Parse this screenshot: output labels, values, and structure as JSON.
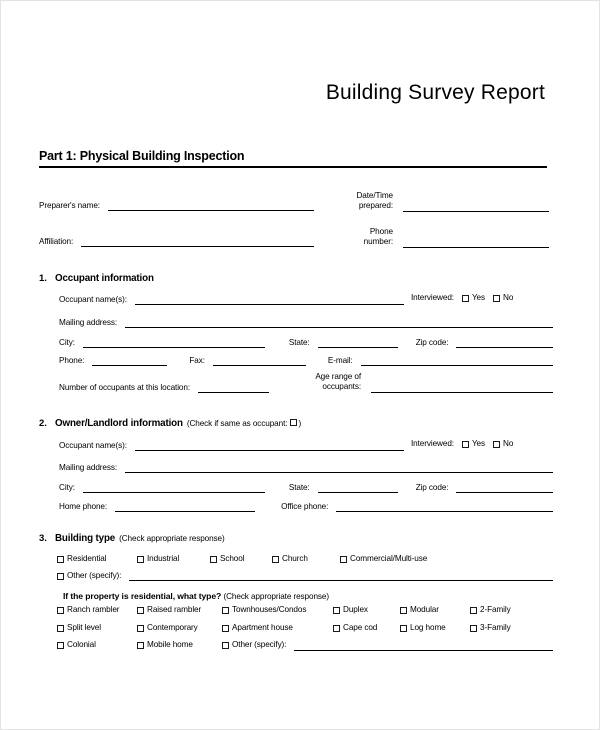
{
  "document": {
    "title": "Building Survey Report",
    "part_header": "Part 1:  Physical Building Inspection"
  },
  "preparer": {
    "name_label": "Preparer's name:",
    "affiliation_label": "Affiliation:",
    "date_label_line1": "Date/Time",
    "date_label_line2": "prepared:",
    "phone_label_line1": "Phone",
    "phone_label_line2": "number:",
    "name_value": "",
    "affiliation_value": "",
    "date_value": "",
    "phone_value": ""
  },
  "section1": {
    "number": "1.",
    "title": "Occupant information",
    "occupant_names_label": "Occupant name(s):",
    "mailing_address_label": "Mailing address:",
    "city_label": "City:",
    "state_label": "State:",
    "zip_label": "Zip code:",
    "phone_label": "Phone:",
    "fax_label": "Fax:",
    "email_label": "E-mail:",
    "num_occupants_label": "Number of occupants at this location:",
    "age_range_label_line1": "Age range of",
    "age_range_label_line2": "occupants:",
    "interviewed_label": "Interviewed:",
    "yes_label": "Yes",
    "no_label": "No"
  },
  "section2": {
    "number": "2.",
    "title": "Owner/Landlord information",
    "note_prefix": "(Check if same as occupant:",
    "note_suffix": ")",
    "occupant_names_label": "Occupant name(s):",
    "mailing_address_label": "Mailing address:",
    "city_label": "City:",
    "state_label": "State:",
    "zip_label": "Zip code:",
    "home_phone_label": "Home phone:",
    "office_phone_label": "Office phone:",
    "interviewed_label": "Interviewed:",
    "yes_label": "Yes",
    "no_label": "No"
  },
  "section3": {
    "number": "3.",
    "title": "Building type",
    "note": "(Check appropriate response)",
    "types": [
      "Residential",
      "Industrial",
      "School",
      "Church",
      "Commercial/Multi-use"
    ],
    "other_label": "Other (specify):",
    "residential_subhead": "If the property is residential, what type?",
    "residential_note": "(Check appropriate response)",
    "residential_rows": [
      [
        "Ranch rambler",
        "Raised rambler",
        "Townhouses/Condos",
        "Duplex",
        "Modular",
        "2-Family"
      ],
      [
        "Split level",
        "Contemporary",
        "Apartment house",
        "Cape cod",
        "Log home",
        "3-Family"
      ],
      [
        "Colonial",
        "Mobile home"
      ]
    ],
    "residential_other_label": "Other (specify):"
  }
}
